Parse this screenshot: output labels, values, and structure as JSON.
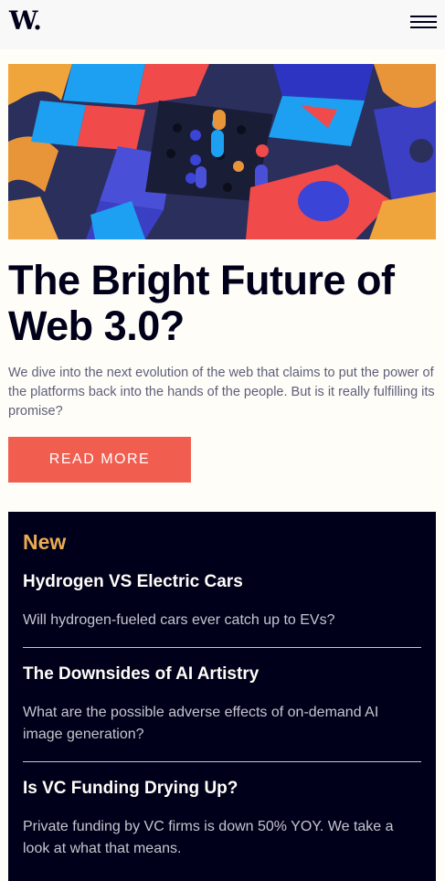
{
  "header": {
    "logo": "W.",
    "menu_icon": "hamburger-menu-icon"
  },
  "hero": {
    "image_label": "abstract 3D blocks illustration",
    "title": "The Bright Future of Web 3.0?",
    "description": "We dive into the next evolution of the web that claims to put the power of the platforms back into the hands of the people. But is it really fulfilling its promise?",
    "cta_label": "READ MORE"
  },
  "new_section": {
    "heading": "New",
    "articles": [
      {
        "title": "Hydrogen VS Electric Cars",
        "summary": "Will hydrogen-fueled cars ever catch up to EVs?"
      },
      {
        "title": "The Downsides of AI Artistry",
        "summary": "What are the possible adverse effects of on-demand AI image generation?"
      },
      {
        "title": "Is VC Funding Drying Up?",
        "summary": "Private funding by VC firms is down 50% YOY. We take a look at what that means."
      }
    ]
  },
  "colors": {
    "accent": "#f15e50",
    "dark": "#00001a",
    "orange": "#e9ab53",
    "background": "#fffdf8"
  }
}
